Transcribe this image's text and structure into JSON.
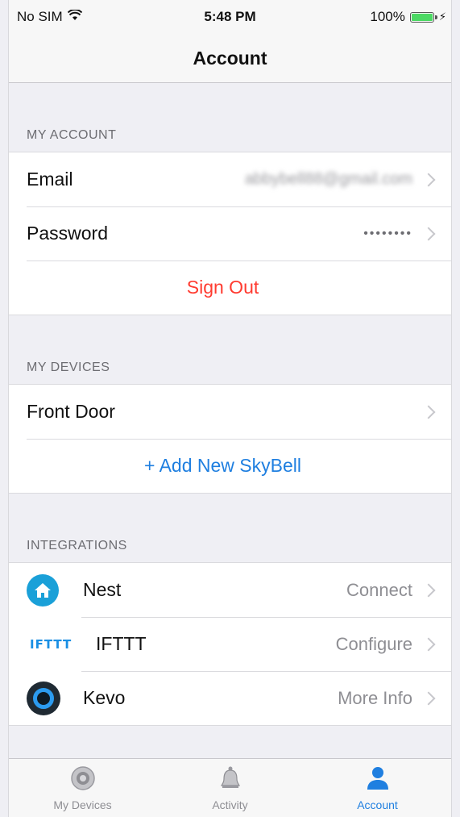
{
  "status": {
    "carrier": "No SIM",
    "time": "5:48 PM",
    "battery": "100%"
  },
  "nav": {
    "title": "Account"
  },
  "my_account": {
    "header": "MY ACCOUNT",
    "email_label": "Email",
    "email_value": "abbybell88@gmail.com",
    "password_label": "Password",
    "password_value": "••••••••",
    "sign_out": "Sign Out"
  },
  "my_devices": {
    "header": "MY DEVICES",
    "device": "Front Door",
    "add_new": "+ Add New SkyBell"
  },
  "integrations": {
    "header": "INTEGRATIONS",
    "items": [
      {
        "name": "Nest",
        "action": "Connect",
        "icon": "nest-icon"
      },
      {
        "name": "IFTTT",
        "action": "Configure",
        "icon": "ifttt-icon",
        "logo_text": "IFTTT"
      },
      {
        "name": "Kevo",
        "action": "More Info",
        "icon": "kevo-icon"
      }
    ]
  },
  "tabs": [
    {
      "label": "My Devices",
      "icon": "camera-icon",
      "active": false
    },
    {
      "label": "Activity",
      "icon": "bell-icon",
      "active": false
    },
    {
      "label": "Account",
      "icon": "person-icon",
      "active": true
    }
  ],
  "colors": {
    "accent": "#1f7fe0",
    "destructive": "#ff3b30",
    "background": "#efeff4"
  }
}
